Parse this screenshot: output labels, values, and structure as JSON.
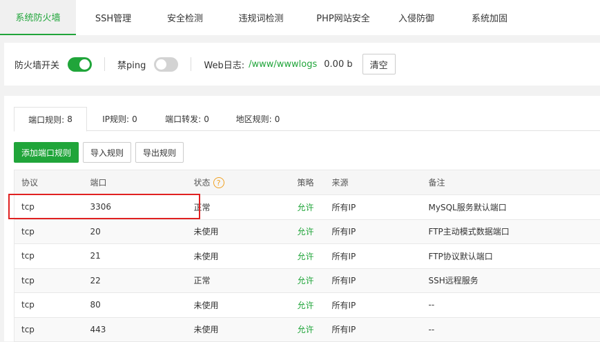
{
  "top_tabs": [
    "系统防火墙",
    "SSH管理",
    "安全检测",
    "违规词检测",
    "PHP网站安全",
    "入侵防御",
    "系统加固"
  ],
  "settings": {
    "firewall_label": "防火墙开关",
    "firewall_on": true,
    "ping_label": "禁ping",
    "ping_on": false,
    "weblog_label": "Web日志:",
    "weblog_path": "/www/wwwlogs",
    "weblog_size": "0.00 b",
    "clear_label": "清空"
  },
  "sub_tabs": [
    {
      "label": "端口规则:",
      "count": "8"
    },
    {
      "label": "IP规则:",
      "count": "0"
    },
    {
      "label": "端口转发:",
      "count": "0"
    },
    {
      "label": "地区规则:",
      "count": "0"
    }
  ],
  "actions": {
    "add_label": "添加端口规则",
    "import_label": "导入规则",
    "export_label": "导出规则"
  },
  "table": {
    "headers": {
      "protocol": "协议",
      "port": "端口",
      "status": "状态",
      "strategy": "策略",
      "source": "来源",
      "note": "备注"
    },
    "rows": [
      {
        "protocol": "tcp",
        "port": "3306",
        "status": "正常",
        "strategy": "允许",
        "source": "所有IP",
        "note": "MySQL服务默认端口"
      },
      {
        "protocol": "tcp",
        "port": "20",
        "status": "未使用",
        "strategy": "允许",
        "source": "所有IP",
        "note": "FTP主动模式数据端口"
      },
      {
        "protocol": "tcp",
        "port": "21",
        "status": "未使用",
        "strategy": "允许",
        "source": "所有IP",
        "note": "FTP协议默认端口"
      },
      {
        "protocol": "tcp",
        "port": "22",
        "status": "正常",
        "strategy": "允许",
        "source": "所有IP",
        "note": "SSH远程服务"
      },
      {
        "protocol": "tcp",
        "port": "80",
        "status": "未使用",
        "strategy": "允许",
        "source": "所有IP",
        "note": "--"
      },
      {
        "protocol": "tcp",
        "port": "443",
        "status": "未使用",
        "strategy": "允许",
        "source": "所有IP",
        "note": "--"
      }
    ]
  },
  "colors": {
    "accent": "#20a53a",
    "highlight": "#e02020",
    "help": "#f0a020"
  }
}
